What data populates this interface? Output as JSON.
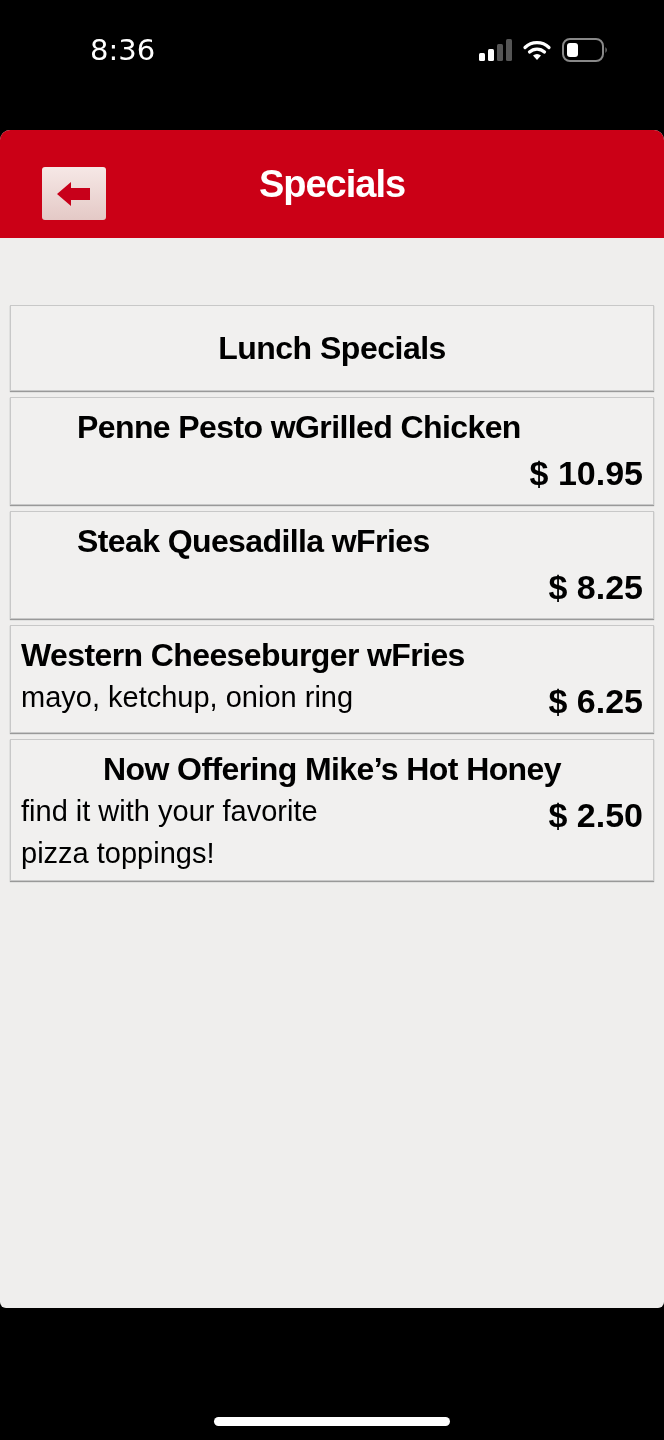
{
  "status_bar": {
    "time": "8:36"
  },
  "header": {
    "title": "Specials"
  },
  "section": {
    "title": "Lunch Specials"
  },
  "items": [
    {
      "name": "Penne Pesto wGrilled Chicken",
      "kind": "indented",
      "price": "$ 10.95"
    },
    {
      "name": "Steak Quesadilla wFries",
      "kind": "indented",
      "price": "$ 8.25"
    },
    {
      "name": "Western Cheeseburger wFries",
      "kind": "plain",
      "description": "mayo, ketchup, onion ring",
      "price": "$ 6.25"
    },
    {
      "name": "Now Offering Mike’s Hot Honey",
      "kind": "centered",
      "description": "find it with your favorite pizza toppings!",
      "price": "$ 2.50"
    }
  ]
}
